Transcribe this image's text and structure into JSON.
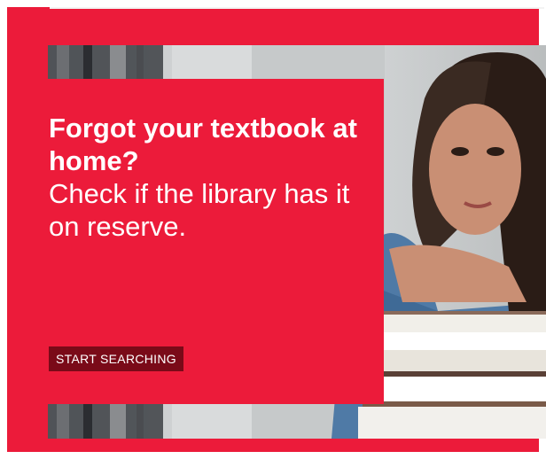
{
  "ad": {
    "headline_bold": "Forgot your textbook at home?",
    "headline_regular": "Check if the library has it on reserve.",
    "cta_label": "START SEARCHING"
  },
  "colors": {
    "brand_red": "#ec1b3a",
    "cta_background": "#7a0a18",
    "text": "#ffffff"
  },
  "image": {
    "subject": "student-portrait-with-books"
  }
}
